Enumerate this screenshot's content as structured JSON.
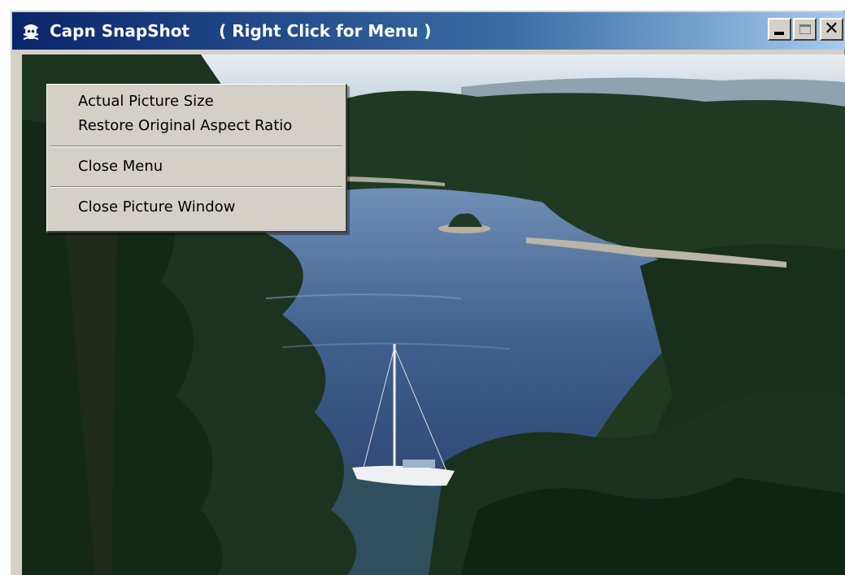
{
  "window": {
    "title": "Capn SnapShot",
    "hint": "( Right Click for Menu )",
    "app_icon": "pirate-skull-icon",
    "caption_buttons": {
      "minimize": "minimize-icon",
      "maximize": "maximize-icon",
      "close_label": "✕",
      "maximize_disabled": true
    },
    "colors": {
      "titlebar_start": "#0a246a",
      "titlebar_end": "#a6caf0",
      "chrome": "#d4d0c8"
    }
  },
  "picture": {
    "subject": "photo"
  },
  "context_menu": {
    "items": [
      {
        "label": "Actual Picture Size"
      },
      {
        "label": "Restore Original Aspect Ratio"
      },
      {
        "label": "Close Menu"
      },
      {
        "label": "Close Picture Window"
      }
    ]
  }
}
